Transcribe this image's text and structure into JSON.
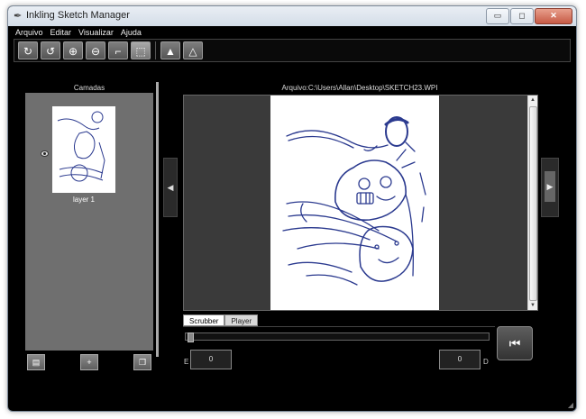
{
  "window": {
    "title": "Inkling Sketch Manager",
    "icon": "pen-icon",
    "controls": [
      "minimize",
      "maximize",
      "close"
    ]
  },
  "menu": [
    "Arquivo",
    "Editar",
    "Visualizar",
    "Ajuda"
  ],
  "toolbar": {
    "tools": [
      {
        "name": "rotate-cw-tool",
        "icon": "rotate-clockwise-icon",
        "glyph": "↻"
      },
      {
        "name": "rotate-ccw-tool",
        "icon": "rotate-counterclockwise-icon",
        "glyph": "↺"
      },
      {
        "name": "zoom-in-tool",
        "icon": "zoom-in-icon",
        "glyph": "⊕"
      },
      {
        "name": "zoom-out-tool",
        "icon": "zoom-out-icon",
        "glyph": "⊖"
      },
      {
        "name": "crop-tool",
        "icon": "crop-icon",
        "glyph": "⌐"
      },
      {
        "name": "select-area-tool",
        "icon": "select-area-icon",
        "glyph": "⬚"
      },
      {
        "name": "import-tool",
        "icon": "import-icon",
        "glyph": "▲"
      },
      {
        "name": "export-tool",
        "icon": "export-icon",
        "glyph": "△"
      }
    ]
  },
  "layers": {
    "title": "Camadas",
    "items": [
      {
        "name": "layer 1",
        "visible": true
      }
    ],
    "buttons": [
      "delete-layer-button",
      "add-layer-button",
      "duplicate-layer-button"
    ]
  },
  "file": {
    "path": "Arquivo:C:\\Users\\Allan\\Desktop\\SKETCH23.WPI"
  },
  "playback": {
    "tabs": [
      "Scrubber",
      "Player"
    ],
    "active_tab": "Scrubber",
    "start_label": "E",
    "start_value": "0",
    "end_label": "D",
    "end_value": "0",
    "scrubber_position": 0
  },
  "colors": {
    "ink": "#2b3a8f",
    "background": "#000000",
    "panel": "#6f6f6f"
  }
}
